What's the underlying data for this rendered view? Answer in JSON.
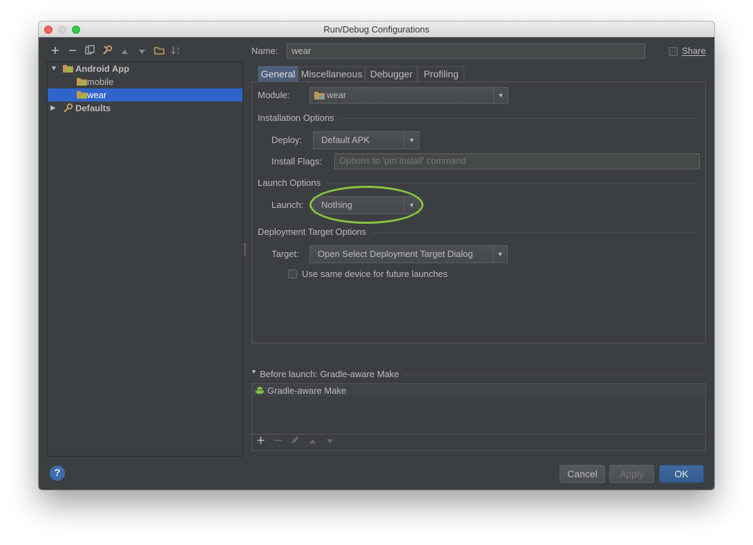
{
  "window": {
    "title": "Run/Debug Configurations"
  },
  "toolbar": {
    "icons": [
      "plus-icon",
      "minus-icon",
      "copy-icon",
      "wrench-icon",
      "arrow-up-icon",
      "arrow-down-icon",
      "folder-icon",
      "sort-icon"
    ]
  },
  "tree": {
    "items": [
      {
        "label": "Android App",
        "level": 0,
        "expanded": true
      },
      {
        "label": "mobile",
        "level": 1
      },
      {
        "label": "wear",
        "level": 1,
        "selected": true
      },
      {
        "label": "Defaults",
        "level": 0,
        "expanded": false
      }
    ]
  },
  "header": {
    "name_label": "Name:",
    "name_value": "wear",
    "share_label": "Share"
  },
  "tabs": [
    {
      "label": "General",
      "active": true
    },
    {
      "label": "Miscellaneous"
    },
    {
      "label": "Debugger"
    },
    {
      "label": "Profiling"
    }
  ],
  "general": {
    "module_label": "Module:",
    "module_value": "wear",
    "installation_title": "Installation Options",
    "deploy_label": "Deploy:",
    "deploy_value": "Default APK",
    "install_flags_label": "Install Flags:",
    "install_flags_placeholder": "Options to 'pm install' command",
    "launch_title": "Launch Options",
    "launch_label": "Launch:",
    "launch_value": "Nothing",
    "target_title": "Deployment Target Options",
    "target_label": "Target:",
    "target_value": "Open Select Deployment Target Dialog",
    "same_device_label": "Use same device for future launches"
  },
  "before_launch": {
    "title": "Before launch: Gradle-aware Make",
    "items": [
      "Gradle-aware Make"
    ]
  },
  "buttons": {
    "cancel": "Cancel",
    "apply": "Apply",
    "ok": "OK",
    "help": "?"
  },
  "colors": {
    "accent": "#2f65ca",
    "highlight_ring": "#8ac43f",
    "background": "#3c3f41"
  }
}
